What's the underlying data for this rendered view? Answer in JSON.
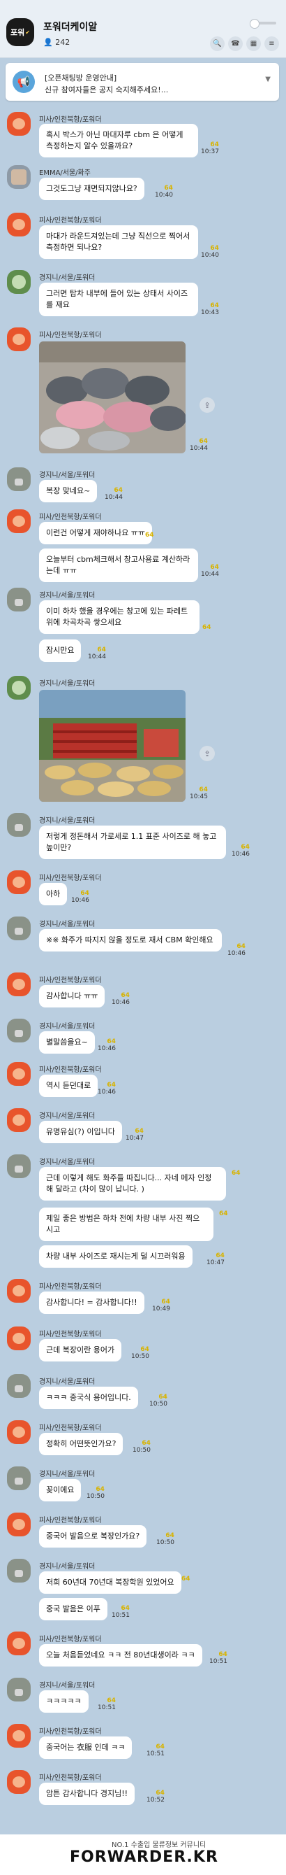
{
  "header": {
    "avatar_text": "포워",
    "title": "포워더케이알",
    "member_count": "242"
  },
  "notice": {
    "line1": "[오픈채팅방 운영안내]",
    "line2": "신규 참여자들은 공지 숙지해주세요!..."
  },
  "messages": [
    {
      "sender": "피사/인천북항/포워더",
      "text": "혹시 박스가 아닌 마대자루 cbm 은 어떻게 측정하는지 알수 있을까요?",
      "unread": "64",
      "time": "10:37"
    },
    {
      "sender": "EMMA/서울/화주",
      "text": "그것도그냥 재면되지않나요?",
      "unread": "64",
      "time": "10:40"
    },
    {
      "sender": "피사/인천북항/포워더",
      "text": "마대가 라운드져있는데 그냥 직선으로 찍어서 측정하면 되나요?",
      "unread": "64",
      "time": "10:40"
    },
    {
      "sender": "경지니/서울/포워더",
      "text": "그러면 탑차 내부에 들어 있는 상태서 사이즈를 재요",
      "unread": "64",
      "time": "10:43"
    },
    {
      "sender": "피사/인천북항/포워더",
      "unread": "64",
      "time": "10:44"
    },
    {
      "sender": "경지니/서울/포워더",
      "text": "복장 맞네요~",
      "unread": "64",
      "time": "10:44"
    },
    {
      "sender": "피사/인천북항/포워더",
      "text": "이런건 어떻게 재야하나요 ㅠㅠ",
      "unread": "64",
      "text2": "오늘부터 cbm체크해서 창고사용료 계산하라는데 ㅠㅠ",
      "unread2": "64",
      "time": "10:44"
    },
    {
      "sender": "경지니/서울/포워더",
      "text": "이미 하차 했을 경우에는 창고에 있는 파레트 위에 차곡차곡 쌓으세요",
      "unread": "64",
      "text2": "잠시만요",
      "unread2": "64",
      "time": "10:44"
    },
    {
      "sender": "경지니/서울/포워더",
      "unread": "64",
      "time": "10:45"
    },
    {
      "sender": "경지니/서울/포워더",
      "text": "저렇게 정돈해서 가로세로 1.1 표준 사이즈로 해 놓고 높이만?",
      "unread": "64",
      "time": "10:46"
    },
    {
      "sender": "피사/인천북항/포워더",
      "text": "아하",
      "unread": "64",
      "time": "10:46"
    },
    {
      "sender": "경지니/서울/포워더",
      "text": "※※ 화주가 따지지 않을 정도로 재서 CBM 확인해요",
      "unread": "64",
      "time": "10:46"
    },
    {
      "sender": "피사/인천북항/포워더",
      "text": "감사합니다 ㅠㅠ",
      "unread": "64",
      "time": "10:46"
    },
    {
      "sender": "경지니/서울/포워더",
      "text": "별말씀을요~",
      "unread": "64",
      "time": "10:46"
    },
    {
      "sender": "피사/인천북항/포워더",
      "text": "역시 듣던대로",
      "unread": "64",
      "time": "10:46"
    },
    {
      "sender": "경지니/서울/포워더",
      "text": "유명유심(?) 이입니다",
      "unread": "64",
      "time": "10:47"
    },
    {
      "sender": "경지니/서울/포워더",
      "text": "근데 이렇게 해도 화주들 따집니다... 자네 메자 인정 해 달라고 (차이 많이 납니다. )",
      "unread": "64",
      "text2": "제일 좋은 방법은 하차 전에 차량 내부 사진 찍으시고",
      "unread2": "64",
      "text3": "차량 내부 사이즈로 재시는게 덜 시끄러워용",
      "unread3": "64",
      "time": "10:47"
    },
    {
      "sender": "피사/인천북항/포워더",
      "text": "감사합니다! = 감사합니다!!",
      "unread": "64",
      "time": "10:49"
    },
    {
      "sender": "피사/인천북항/포워더",
      "text": "근데 복장이란 용어가",
      "unread": "64",
      "time": "10:50"
    },
    {
      "sender": "경지니/서울/포워더",
      "text": "ㅋㅋㅋ 중국식 용어입니다.",
      "unread": "64",
      "time": "10:50"
    },
    {
      "sender": "피사/인천북항/포워더",
      "text": "정확히 어떤뜻인가요?",
      "unread": "64",
      "time": "10:50"
    },
    {
      "sender": "경지니/서울/포워더",
      "text": "꽂이에요",
      "unread": "64",
      "time": "10:50"
    },
    {
      "sender": "피사/인천북항/포워더",
      "text": "중국어 발음으로 복장인가요?",
      "unread": "64",
      "time": "10:50"
    },
    {
      "sender": "경지니/서울/포워더",
      "text": "저희 60년대 70년대 복장학원 있었어요",
      "unread": "64",
      "text2": "중국 발음은 이푸",
      "unread2": "64",
      "time": "10:51"
    },
    {
      "sender": "피사/인천북항/포워더",
      "text": "오늘 처음듣었네요 ㅋㅋ 전 80년대생이라 ㅋㅋ",
      "unread": "64",
      "time": "10:51"
    },
    {
      "sender": "경지니/서울/포워더",
      "text": "ㅋㅋㅋㅋㅋ",
      "unread": "64",
      "time": "10:51"
    },
    {
      "sender": "피사/인천북항/포워더",
      "text": "중국어는 衣服 인데 ㅋㅋ",
      "unread": "64",
      "time": "10:51"
    },
    {
      "sender": "피사/인천북항/포워더",
      "text": "암튼 감사합니다 경지님!!",
      "unread": "64",
      "time": "10:52"
    }
  ],
  "footer": {
    "tagline": "NO.1 수출입 물류정보 커뮤니티",
    "logo": "FORWARDER.KR"
  }
}
